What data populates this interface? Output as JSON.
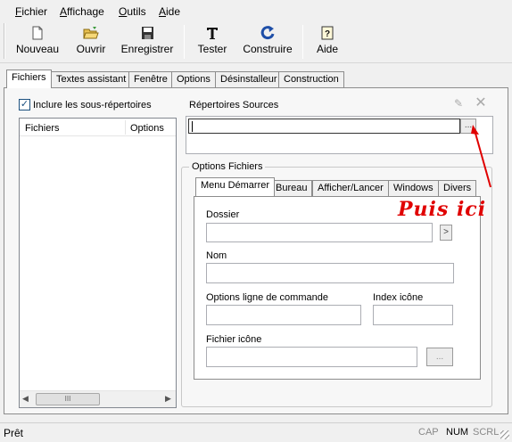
{
  "menu": {
    "fichier": "Fichier",
    "affichage": "Affichage",
    "outils": "Outils",
    "aide": "Aide"
  },
  "toolbar": {
    "nouveau": "Nouveau",
    "ouvrir": "Ouvrir",
    "enregistrer": "Enregistrer",
    "tester": "Tester",
    "construire": "Construire",
    "aide": "Aide"
  },
  "tabs": [
    "Fichiers",
    "Textes assistant",
    "Fenêtre",
    "Options",
    "Désinstalleur",
    "Construction"
  ],
  "fichiers": {
    "include_subdirs": "Inclure les sous-répertoires",
    "col_fichiers": "Fichiers",
    "col_options": "Options",
    "scroll_grip": "III",
    "source_dirs_label": "Répertoires Sources",
    "browse_btn": "...",
    "annotation": "Puis ici"
  },
  "options_fichiers": {
    "legend": "Options Fichiers",
    "tabs": [
      "Menu Démarrer",
      "Bureau",
      "Afficher/Lancer",
      "Windows",
      "Divers"
    ],
    "dossier_label": "Dossier",
    "dossier_btn": ">",
    "nom_label": "Nom",
    "cmdline_label": "Options ligne de commande",
    "icon_index_label": "Index icône",
    "icon_file_label": "Fichier icône",
    "icon_file_btn": "..."
  },
  "status": {
    "text": "Prêt",
    "cap": "CAP",
    "num": "NUM",
    "scrl": "SCRL"
  },
  "colors": {
    "annotation": "#e00000",
    "construire_icon": "#1f4fa8"
  }
}
